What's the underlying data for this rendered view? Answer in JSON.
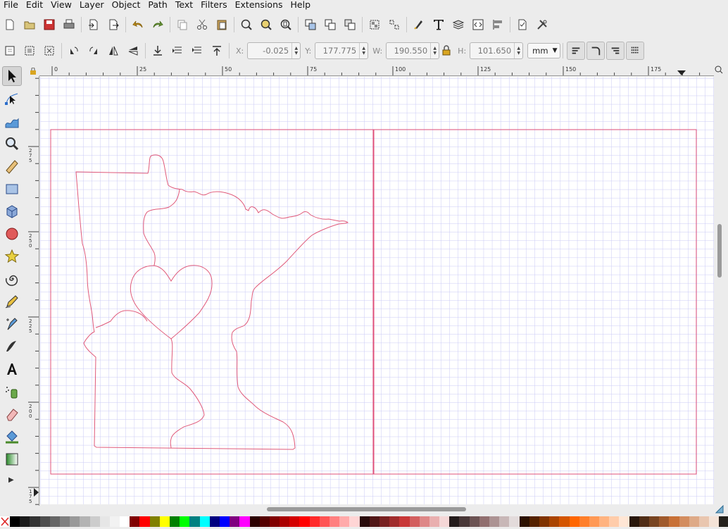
{
  "menu": [
    "File",
    "Edit",
    "View",
    "Layer",
    "Object",
    "Path",
    "Text",
    "Filters",
    "Extensions",
    "Help"
  ],
  "controls": {
    "x_label": "X:",
    "x_value": "-0.025",
    "y_label": "Y:",
    "y_value": "177.775",
    "w_label": "W:",
    "w_value": "190.550",
    "h_label": "H:",
    "h_value": "101.650",
    "unit": "mm"
  },
  "ruler": {
    "h_ticks": [
      "0",
      "25",
      "50",
      "75",
      "100",
      "125",
      "150",
      "175"
    ],
    "v_ticks": [
      "275",
      "250",
      "225",
      "200",
      "175"
    ]
  },
  "colors": {
    "grid": "#c9c9f5",
    "page_border": "#e0507a",
    "drawing": "#e05a7a"
  },
  "palette": [
    "#000000",
    "#1a1a1a",
    "#333333",
    "#4d4d4d",
    "#666666",
    "#808080",
    "#999999",
    "#b3b3b3",
    "#cccccc",
    "#e6e6e6",
    "#f2f2f2",
    "#ffffff",
    "#800000",
    "#ff0000",
    "#808000",
    "#ffff00",
    "#008000",
    "#00ff00",
    "#008080",
    "#00ffff",
    "#000080",
    "#0000ff",
    "#800080",
    "#ff00ff",
    "#2b0000",
    "#550000",
    "#800000",
    "#aa0000",
    "#d40000",
    "#ff0000",
    "#ff2a2a",
    "#ff5555",
    "#ff8080",
    "#ffaaaa",
    "#ffd5d5",
    "#280b0b",
    "#501616",
    "#782121",
    "#a02c2c",
    "#c83737",
    "#d35f5f",
    "#de8787",
    "#e9afaf",
    "#f4d7d7",
    "#241c1c",
    "#483737",
    "#6c5353",
    "#916f6f",
    "#ac9393",
    "#c8b7b7",
    "#e3dbdb",
    "#2b1100",
    "#552200",
    "#803300",
    "#aa4400",
    "#d45500",
    "#ff6600",
    "#ff7f2a",
    "#ff9955",
    "#ffb380",
    "#ffccaa",
    "#ffe6d5",
    "#28170b",
    "#502d16",
    "#784421",
    "#a05a2c",
    "#c87137",
    "#d38d5f",
    "#deaa87",
    "#e9c6af",
    "#f4e3d7",
    "#24211c",
    "#484137"
  ]
}
